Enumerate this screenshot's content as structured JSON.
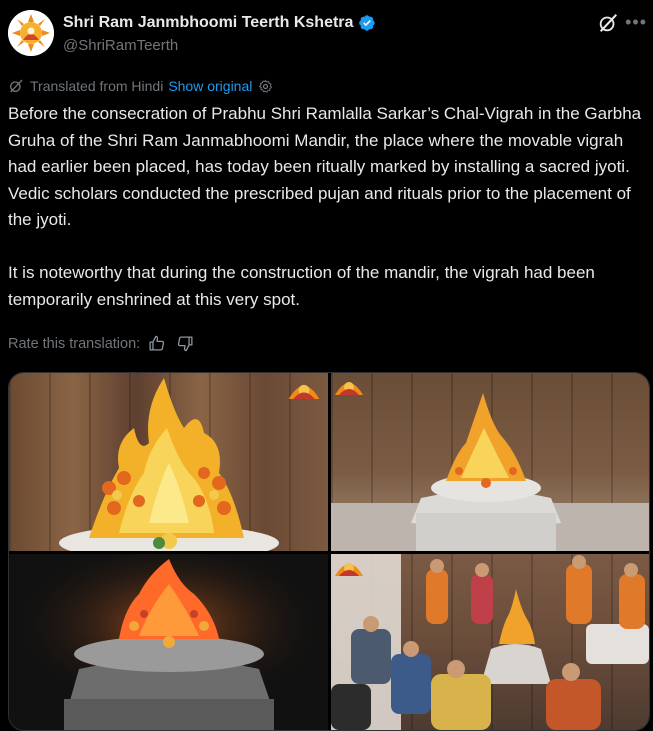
{
  "author": {
    "display_name": "Shri Ram Janmbhoomi Teerth Kshetra",
    "handle": "@ShriRamTeerth",
    "verified_color": "#1d9bf0"
  },
  "icons": {
    "avatar": "avatar-logo",
    "verified": "verified-badge-icon",
    "grok": "grok-icon",
    "more": "more-icon",
    "translate": "translate-icon",
    "settings": "gear-icon",
    "thumbs_up": "thumbs-up-icon",
    "thumbs_down": "thumbs-down-icon"
  },
  "translation": {
    "label": "Translated from Hindi",
    "show_original": "Show original",
    "rate_label": "Rate this translation:"
  },
  "post": {
    "paragraph1": "Before the consecration of Prabhu Shri Ramlalla Sarkar’s Chal-Vigrah in the Garbha Gruha of the Shri Ram Janmabhoomi Mandir, the place where the movable vigrah had earlier been placed, has today been ritually marked by installing a sacred jyoti. Vedic scholars conducted the prescribed pujan and rituals prior to the placement of the jyoti.",
    "paragraph2": "It is noteworthy that during the construction of the mandir, the vigrah had been temporarily enshrined at this very spot."
  },
  "media": {
    "count": 4,
    "images": [
      "jyoti-closeup",
      "jyoti-on-pedestal",
      "jyoti-lit-dark",
      "pujan-ceremony"
    ]
  },
  "colors": {
    "background": "#000000",
    "text": "#e7e9ea",
    "muted": "#71767b",
    "link": "#1d9bf0"
  }
}
